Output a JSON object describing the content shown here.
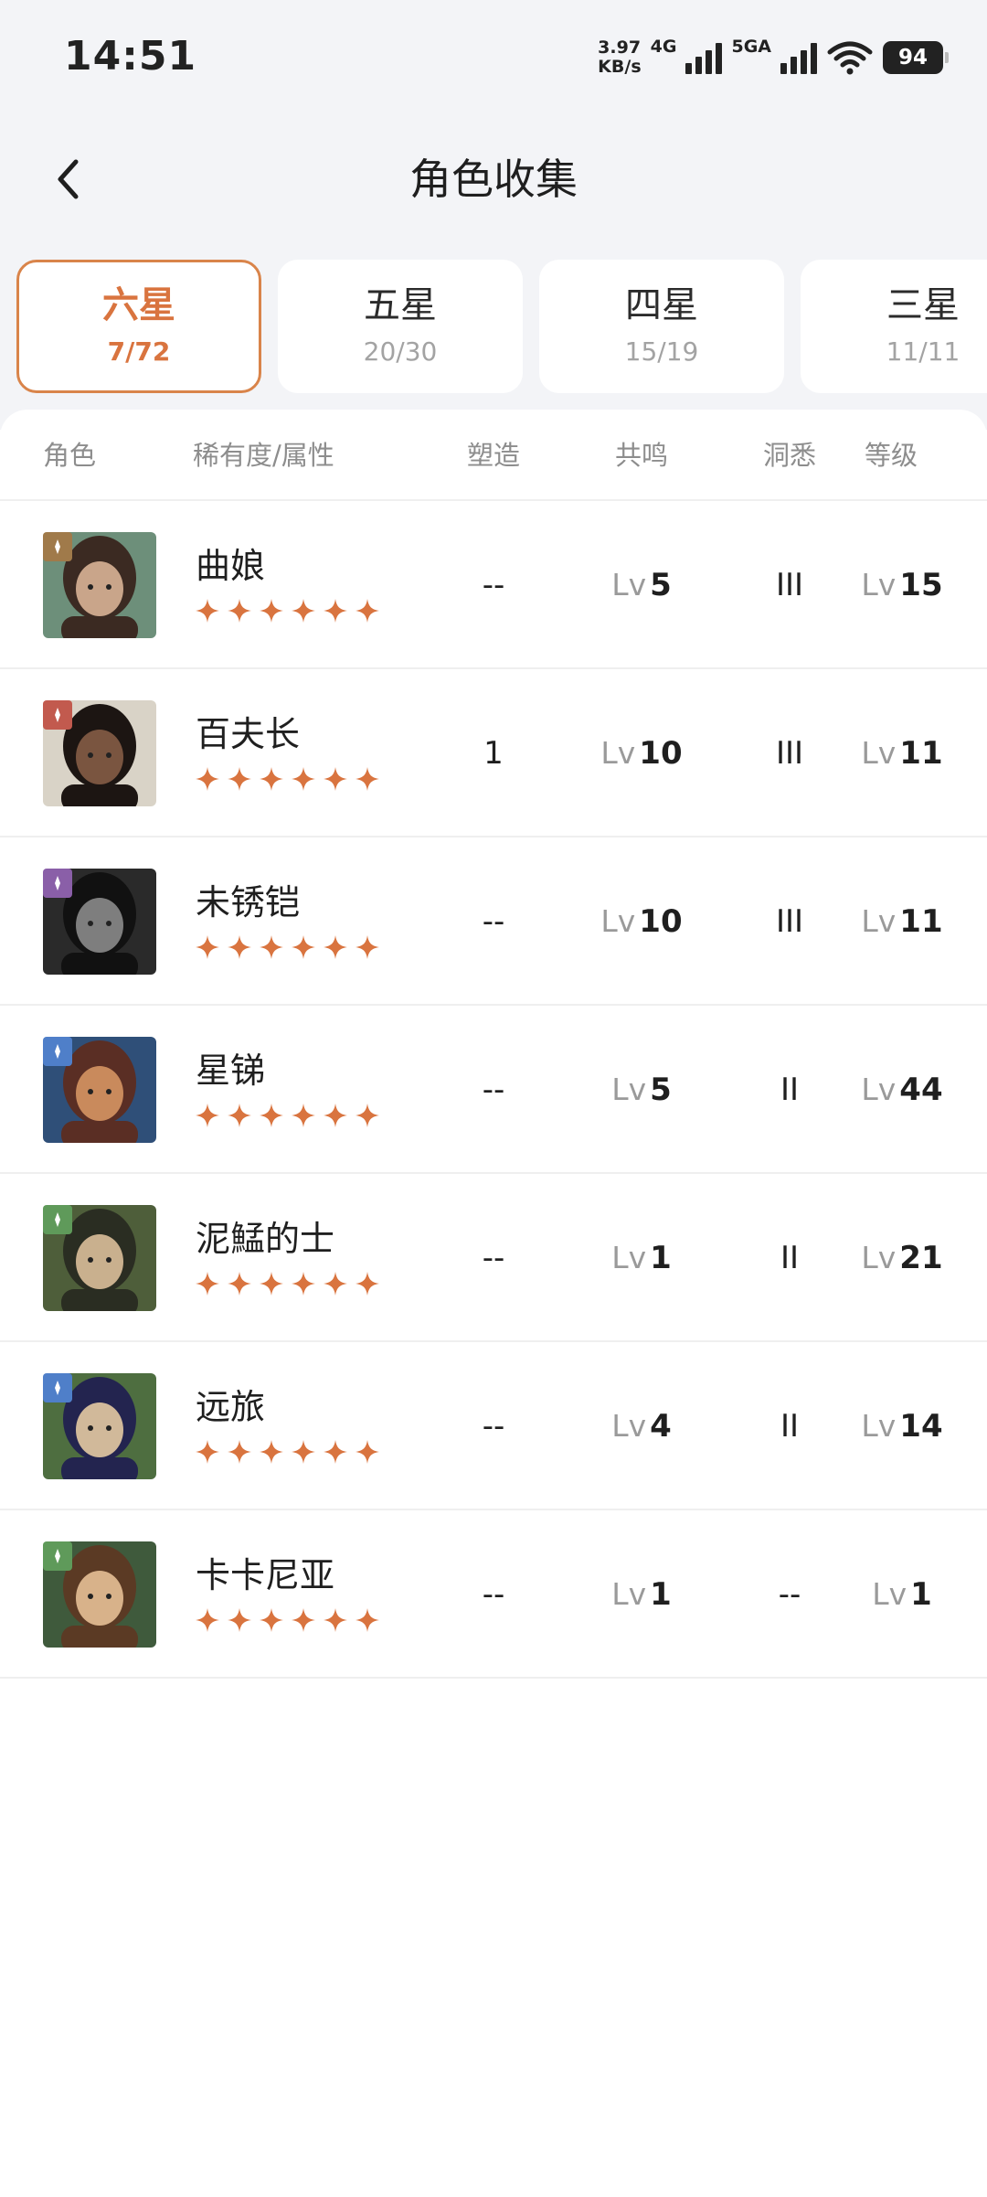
{
  "status_bar": {
    "time": "14:51",
    "net_speed_value": "3.97",
    "net_speed_unit": "KB/s",
    "net_type_1": "4G",
    "net_type_2": "5GA",
    "battery": "94"
  },
  "header": {
    "title": "角色收集"
  },
  "tabs": [
    {
      "label": "六星",
      "count": "7/72",
      "active": true
    },
    {
      "label": "五星",
      "count": "20/30",
      "active": false
    },
    {
      "label": "四星",
      "count": "15/19",
      "active": false
    },
    {
      "label": "三星",
      "count": "11/11",
      "active": false
    }
  ],
  "columns": {
    "character": "角色",
    "rarity": "稀有度/属性",
    "shaping": "塑造",
    "resonance": "共鸣",
    "insight": "洞悉",
    "level": "等级"
  },
  "lv_prefix": "Lv",
  "accent_color": "#d9743f",
  "characters": [
    {
      "name": "曲娘",
      "stars": 6,
      "element_icon": "element-icon-brown",
      "element_color": "#a07a4a",
      "shaping": "--",
      "resonance": "5",
      "insight": "III",
      "level": "15"
    },
    {
      "name": "百夫长",
      "stars": 6,
      "element_icon": "element-icon-red",
      "element_color": "#c25a4e",
      "shaping": "1",
      "resonance": "10",
      "insight": "III",
      "level": "11"
    },
    {
      "name": "未锈铠",
      "stars": 6,
      "element_icon": "element-icon-purple",
      "element_color": "#8a5fa8",
      "shaping": "--",
      "resonance": "10",
      "insight": "III",
      "level": "11"
    },
    {
      "name": "星锑",
      "stars": 6,
      "element_icon": "element-icon-blue",
      "element_color": "#4f7fc9",
      "shaping": "--",
      "resonance": "5",
      "insight": "II",
      "level": "44"
    },
    {
      "name": "泥鯭的士",
      "stars": 6,
      "element_icon": "element-icon-green",
      "element_color": "#5f9a5a",
      "shaping": "--",
      "resonance": "1",
      "insight": "II",
      "level": "21"
    },
    {
      "name": "远旅",
      "stars": 6,
      "element_icon": "element-icon-blue",
      "element_color": "#4f7fc9",
      "shaping": "--",
      "resonance": "4",
      "insight": "II",
      "level": "14"
    },
    {
      "name": "卡卡尼亚",
      "stars": 6,
      "element_icon": "element-icon-green",
      "element_color": "#5f9a5a",
      "shaping": "--",
      "resonance": "1",
      "insight": "--",
      "level": "1"
    }
  ]
}
